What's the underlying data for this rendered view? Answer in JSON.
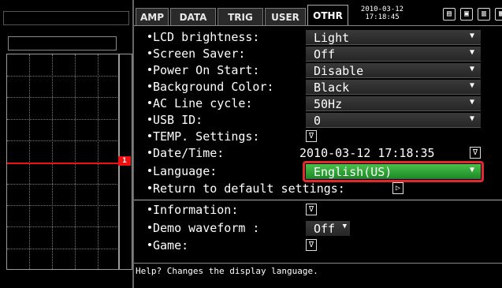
{
  "tabs": [
    "AMP",
    "DATA",
    "TRIG",
    "USER",
    "OTHR"
  ],
  "active_tab": "OTHR",
  "datetime": {
    "date": "2010-03-12",
    "time": "17:18:45"
  },
  "channel_marker": "1",
  "settings": {
    "lcd_brightness": {
      "label": "LCD brightness:",
      "value": "Light"
    },
    "screen_saver": {
      "label": "Screen Saver:",
      "value": "Off"
    },
    "power_on_start": {
      "label": "Power On Start:",
      "value": "Disable"
    },
    "background_color": {
      "label": "Background Color:",
      "value": "Black"
    },
    "ac_line_cycle": {
      "label": "AC Line cycle:",
      "value": "50Hz"
    },
    "usb_id": {
      "label": "USB ID:",
      "value": "0"
    },
    "temp_settings": {
      "label": "TEMP. Settings:"
    },
    "date_time": {
      "label": "Date/Time:",
      "value": "2010-03-12 17:18:35"
    },
    "language": {
      "label": "Language:",
      "value": "English(US)"
    },
    "return_default": {
      "label": "Return to default settings:"
    },
    "information": {
      "label": "Information:"
    },
    "demo_waveform": {
      "label": "Demo waveform :",
      "value": "Off"
    },
    "game": {
      "label": "Game:"
    }
  },
  "help_text": "Help? Changes the display language.",
  "icons": {
    "dropdown": "▼",
    "expand": "∇",
    "play": "▷"
  },
  "colors": {
    "selected": "#2ea83a",
    "highlight": "#e22a2a",
    "trace": "#e11111"
  }
}
